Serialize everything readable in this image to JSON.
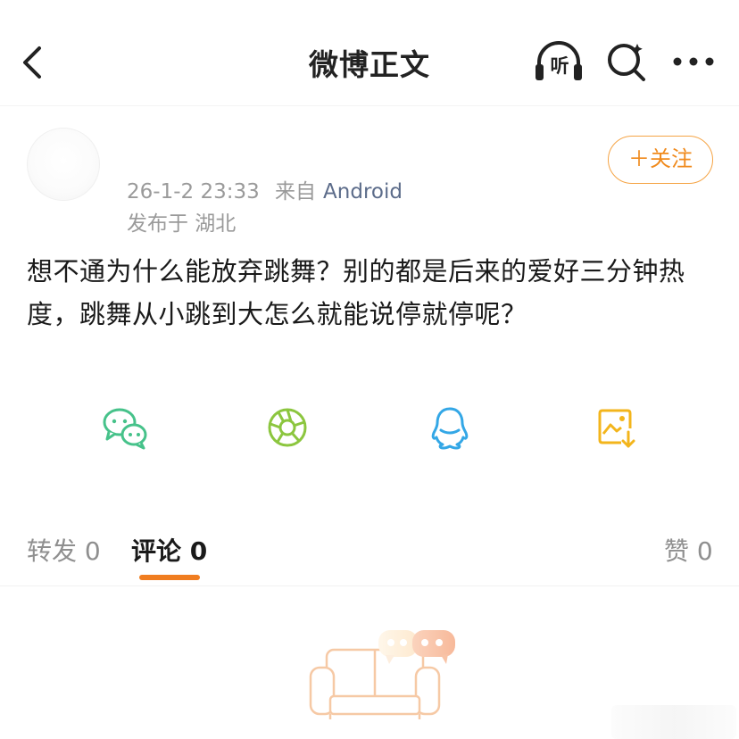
{
  "header": {
    "title": "微博正文",
    "listen_label": "听",
    "icons": [
      "back-arrow-icon",
      "headphones-icon",
      "search-icon",
      "more-icon"
    ]
  },
  "post": {
    "time": "26-1-2 23:33",
    "source_prefix": "来自",
    "source": "Android",
    "location": "发布于 湖北",
    "follow_label": "＋关注",
    "text": "想不通为什么能放弃跳舞？别的都是后来的爱好三分钟热度，跳舞从小跳到大怎么就能说停就停呢？"
  },
  "share": {
    "items": [
      "wechat-icon",
      "moments-icon",
      "qq-icon",
      "save-image-icon"
    ]
  },
  "tabs": {
    "repost": "转发 0",
    "comment": "评论 0",
    "like": "赞 0"
  },
  "colors": {
    "accent": "#f07d20",
    "follow_border": "#f5a445",
    "wechat": "#46c28a",
    "moments": "#8cc63f",
    "qq": "#33a7e6",
    "save_image": "#f3b51c",
    "meta_gray": "#9a9a9a",
    "source_blue": "#5c6c8a"
  }
}
